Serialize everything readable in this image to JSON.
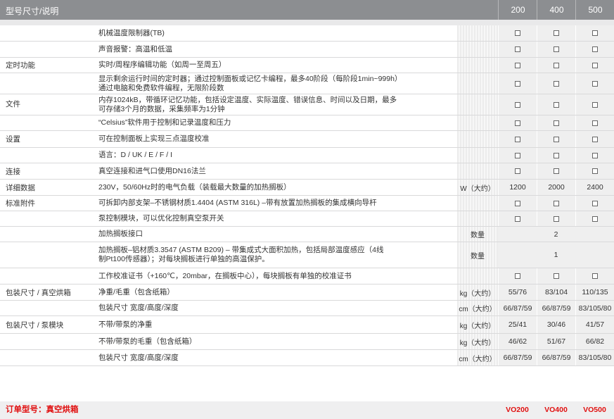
{
  "header": {
    "title": "型号尺寸/说明",
    "models": [
      "200",
      "400",
      "500"
    ]
  },
  "rows": [
    {
      "cat": "",
      "desc": "机械温度限制器(TB)",
      "unit": "",
      "vals": [
        "□",
        "□",
        "□"
      ]
    },
    {
      "cat": "",
      "desc": "声音报警：高温和低温",
      "unit": "",
      "vals": [
        "□",
        "□",
        "□"
      ]
    },
    {
      "cat": "定时功能",
      "desc": "实时/周程序编辑功能（如周一至周五）",
      "unit": "",
      "vals": [
        "□",
        "□",
        "□"
      ]
    },
    {
      "cat": "",
      "desc": "显示剩余运行时间的定时器；通过控制面板或记忆卡编程，最多40阶段（每阶段1min~999h）\n通过电脑和免费软件编程，无限阶段数",
      "unit": "",
      "vals": [
        "□",
        "□",
        "□"
      ]
    },
    {
      "cat": "文件",
      "desc": "内存1024kB，带循环记忆功能，包括设定温度、实际温度、错误信息、时间以及日期，最多\n可存储3个月的数据，采集频率为1分钟",
      "unit": "",
      "vals": [
        "□",
        "□",
        "□"
      ]
    },
    {
      "cat": "",
      "desc": "“Celsius”软件用于控制和记录温度和压力",
      "unit": "",
      "vals": [
        "□",
        "□",
        "□"
      ]
    },
    {
      "cat": "设置",
      "desc": "可在控制面板上实现三点温度校准",
      "unit": "",
      "vals": [
        "□",
        "□",
        "□"
      ]
    },
    {
      "cat": "",
      "desc": "语言：D / UK / E / F / I",
      "unit": "",
      "vals": [
        "□",
        "□",
        "□"
      ]
    },
    {
      "cat": "连接",
      "desc": "真空连接和进气口使用DN16法兰",
      "unit": "",
      "vals": [
        "□",
        "□",
        "□"
      ]
    },
    {
      "cat": "详细数据",
      "desc": "230V，50/60Hz时的电气负载（装载最大数量的加热搁板）",
      "unit": "W（大约）",
      "vals": [
        "1200",
        "2000",
        "2400"
      ]
    },
    {
      "cat": "标准附件",
      "desc": "可拆卸内部支架–不锈钢材质1.4404 (ASTM 316L) –带有放置加热搁板的集成横向导杆",
      "unit": "",
      "vals": [
        "□",
        "□",
        "□"
      ]
    },
    {
      "cat": "",
      "desc": "泵控制模块，可以优化控制真空泵开关",
      "unit": "",
      "vals": [
        "□",
        "□",
        "□"
      ]
    },
    {
      "cat": "",
      "desc": "加热搁板接口",
      "unit": "数量",
      "merged": "2"
    },
    {
      "cat": "",
      "desc": "加热搁板–铝材质3.3547 (ASTM B209) – 带集成式大面积加热，包括局部温度感应（4线\n制Pt100传感器）；对每块搁板进行单独的高温保护。",
      "unit": "数量",
      "merged": "1"
    },
    {
      "cat": "",
      "desc": "工作校准证书（+160℃，20mbar，在搁板中心），每块搁板有单独的校准证书",
      "unit": "",
      "vals": [
        "□",
        "□",
        "□"
      ]
    },
    {
      "cat": "包装尺寸 / 真空烘箱",
      "desc": "净重/毛重（包含纸箱）",
      "unit": "kg（大约）",
      "vals": [
        "55/76",
        "83/104",
        "110/135"
      ]
    },
    {
      "cat": "",
      "desc": "包装尺寸 宽度/高度/深度",
      "unit": "cm（大约）",
      "vals": [
        "66/87/59",
        "66/87/59",
        "83/105/80"
      ]
    },
    {
      "cat": "包装尺寸 / 泵模块",
      "desc": "不带/带泵的净重",
      "unit": "kg（大约）",
      "vals": [
        "25/41",
        "30/46",
        "41/57"
      ]
    },
    {
      "cat": "",
      "desc": "不带/带泵的毛重（包含纸箱）",
      "unit": "kg（大约）",
      "vals": [
        "46/62",
        "51/67",
        "66/82"
      ]
    },
    {
      "cat": "",
      "desc": "包装尺寸 宽度/高度/深度",
      "unit": "cm（大约）",
      "vals": [
        "66/87/59",
        "66/87/59",
        "83/105/80"
      ]
    }
  ],
  "footer": {
    "label": "订单型号：真空烘箱",
    "codes": [
      "VO200",
      "VO400",
      "VO500"
    ]
  }
}
